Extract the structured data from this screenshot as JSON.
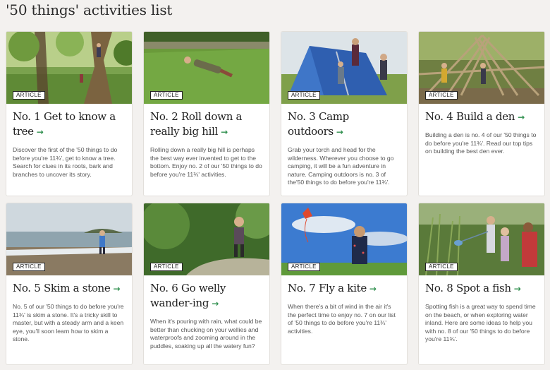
{
  "page": {
    "title": "'50 things' activities list"
  },
  "colors": {
    "accent_arrow": "#2f8f4e",
    "background": "#f3f1ef",
    "card": "#ffffff"
  },
  "cards": [
    {
      "badge": "ARTICLE",
      "title": "No. 1 Get to know a tree",
      "arrow": "→",
      "image": "woodland-tree-climbing",
      "description": "Discover the first of the '50 things to do before you're 11¾', get to know a tree. Search for clues in its roots, bark and branches to uncover its story."
    },
    {
      "badge": "ARTICLE",
      "title": "No. 2 Roll down a really big hill",
      "arrow": "→",
      "image": "child-rolling-on-grass",
      "description": "Rolling down a really big hill is perhaps the best way ever invented to get to the bottom. Enjoy no. 2 of our '50 things to do before you're 11¾' activities."
    },
    {
      "badge": "ARTICLE",
      "title": "No. 3 Camp outdoors",
      "arrow": "→",
      "image": "children-by-tent",
      "description": "Grab your torch and head for the wilderness. Wherever you choose to go camping, it will be a fun adventure in nature. Camping outdoors is no. 3 of the'50 things to do before you're 11¾'."
    },
    {
      "badge": "ARTICLE",
      "title": "No. 4 Build a den",
      "arrow": "→",
      "image": "stick-den",
      "description": "Building a den is no. 4 of our '50 things to do before you're 11¾'. Read our top tips on building the best den ever."
    },
    {
      "badge": "ARTICLE",
      "title": "No. 5 Skim a stone",
      "arrow": "→",
      "image": "beach-stone-skimming",
      "description": "No. 5 of our '50 things to do before you're 11¾' is skim a stone. It's a tricky skill to master, but with a steady arm and a keen eye, you'll soon learn how to skim a stone."
    },
    {
      "badge": "ARTICLE",
      "title": "No. 6 Go welly wander-ing",
      "arrow": "→",
      "image": "child-in-wellies-woodland",
      "description": "When it's pouring with rain, what could be better than chucking on your wellies and waterproofs and zooming around in the puddles, soaking up all the watery fun?"
    },
    {
      "badge": "ARTICLE",
      "title": "No. 7 Fly a kite",
      "arrow": "→",
      "image": "child-flying-kite",
      "description": "When there's a bit of wind in the air it's the perfect time to enjoy no. 7 on our list of '50 things to do before you're 11¾' activities."
    },
    {
      "badge": "ARTICLE",
      "title": "No. 8 Spot a fish",
      "arrow": "→",
      "image": "children-pond-dipping",
      "description": "Spotting fish is a great way to spend time on the beach, or when exploring water inland. Here are some ideas to help you with no. 8 of our '50 things to do before you're 11¾'."
    }
  ]
}
